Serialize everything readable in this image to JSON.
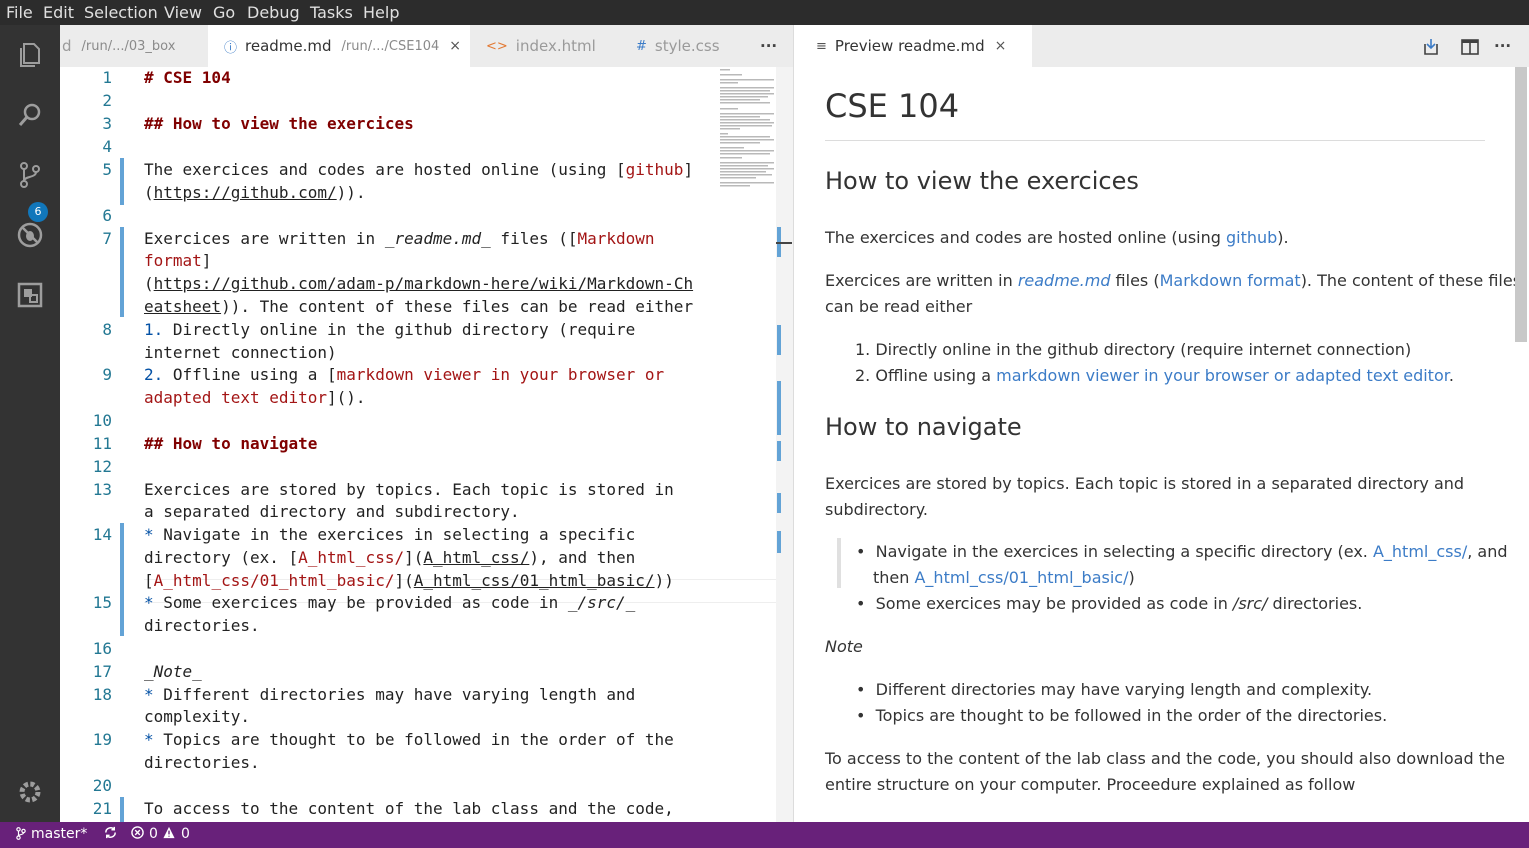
{
  "menu": [
    "File",
    "Edit",
    "Selection",
    "View",
    "Go",
    "Debug",
    "Tasks",
    "Help"
  ],
  "activity": {
    "scm_badge": "6"
  },
  "tabs": [
    {
      "label": "d",
      "desc": "/run/.../03_box"
    },
    {
      "label": "readme.md",
      "desc": "/run/.../CSE104",
      "icon": "ⓘ",
      "close": "×"
    },
    {
      "label": "index.html",
      "icon": "<>"
    },
    {
      "label": "style.css",
      "icon": "#"
    }
  ],
  "more": "···",
  "preview_tab": {
    "icon": "≡",
    "label": "Preview readme.md",
    "close": "×"
  },
  "line_numbers": [
    "1",
    "2",
    "3",
    "4",
    "5",
    "6",
    "7",
    "8",
    "9",
    "10",
    "11",
    "12",
    "13",
    "14",
    "15",
    "16",
    "17",
    "18",
    "19",
    "20",
    "21"
  ],
  "code": {
    "l1": "# CSE 104",
    "l3": "## How to view the exercices",
    "l5a": "The exercices and codes are hosted online (using [",
    "l5b": "github",
    "l5c": "]",
    "l5d": "(",
    "l5e": "https://github.com/",
    "l5f": ")).",
    "l7a": "Exercices are written in ",
    "l7b": "_readme.md_",
    "l7c": " files ([",
    "l7d": "Markdown",
    "l7e": "format",
    "l7f": "]",
    "l7g": "(",
    "l7h": "https://github.com/adam-p/markdown-here/wiki/Markdown-Ch",
    "l7i": "eatsheet",
    "l7j": ")). The content of these files can be read either",
    "l8a": "1.",
    "l8b": " Directly online in the github directory (require",
    "l8c": "internet connection)",
    "l9a": "2.",
    "l9b": " Offline using a [",
    "l9c": "markdown viewer in your browser or",
    "l9d": "adapted text editor",
    "l9e": "]().",
    "l11": "## How to navigate",
    "l13a": "Exercices are stored by topics. Each topic is stored in",
    "l13b": "a separated directory and subdirectory.",
    "l14a1": "*",
    "l14a2": " Navigate in the exercices in selecting a specific",
    "l14b1": "directory (ex. [",
    "l14b2": "A_html_css/",
    "l14b3": "](",
    "l14b4": "A_html_css/",
    "l14b5": "), and then",
    "l14c1": "[",
    "l14c2": "A_html_css/01_html_basic/",
    "l14c3": "](",
    "l14c4": "A_html_css/01_html_basic/",
    "l14c5": "))",
    "l15a1": "*",
    "l15a2": " Some exercices may be provided as code in ",
    "l15a3": "_/src/_",
    "l15b": "directories.",
    "l17": "_Note_",
    "l18a1": "*",
    "l18a2": " Different directories may have varying length and",
    "l18b": "complexity.",
    "l19a1": "*",
    "l19a2": " Topics are thought to be followed in the order of the",
    "l19b": "directories.",
    "l21": "To access to the content of the lab class and the code,"
  },
  "preview": {
    "h1": "CSE 104",
    "h2a": "How to view the exercices",
    "p1a": "The exercices and codes are hosted online (using ",
    "p1b": "github",
    "p1c": ").",
    "p2a": "Exercices are written in ",
    "p2b": "readme.md",
    "p2c": " files (",
    "p2d": "Markdown format",
    "p2e": "). The content of these files",
    "p2f": "can be read either",
    "ol1": "Directly online in the github directory (require internet connection)",
    "ol2a": "Offline using a ",
    "ol2b": "markdown viewer in your browser or adapted text editor",
    "ol2c": ".",
    "h2b": "How to navigate",
    "p3a": "Exercices are stored by topics. Each topic is stored in a separated directory and",
    "p3b": "subdirectory.",
    "li1a": "Navigate in the exercices in selecting a specific directory (ex. ",
    "li1b": "A_html_css/",
    "li1c": ", and",
    "li1d": "then ",
    "li1e": "A_html_css/01_html_basic/",
    "li1f": ")",
    "li2a": "Some exercices may be provided as code in ",
    "li2b": "/src/",
    "li2c": " directories.",
    "note": "Note",
    "li3": "Different directories may have varying length and complexity.",
    "li4": "Topics are thought to be followed in the order of the directories.",
    "p4a": "To access to the content of the lab class and the code, you should also download the",
    "p4b": "entire structure on your computer. Proceedure explained as follow",
    "bullet": "•",
    "n1": "1.",
    "n2": "2."
  },
  "status": {
    "branch": "master*",
    "errors": "0",
    "warnings": "0"
  }
}
